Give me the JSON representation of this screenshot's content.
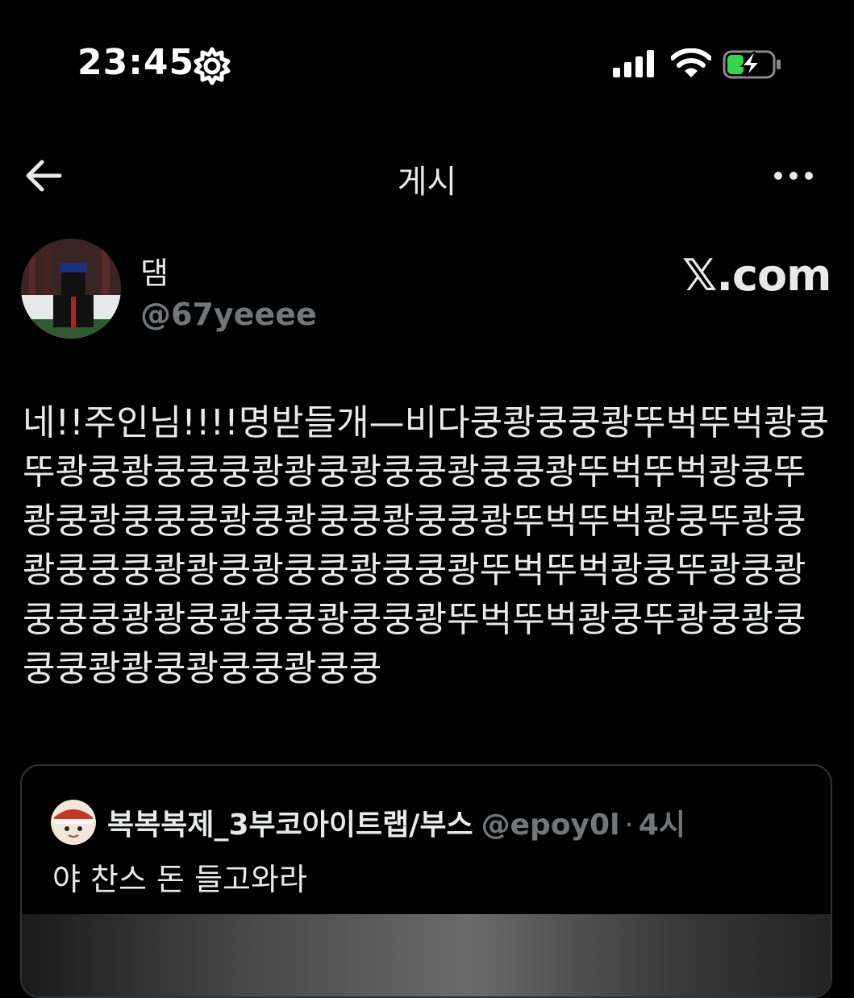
{
  "status_bar": {
    "time": "23:45",
    "icons": [
      "gear-icon",
      "signal-icon",
      "wifi-icon",
      "battery-charging-icon"
    ]
  },
  "header": {
    "title": "게시",
    "back_icon": "arrow-left-icon",
    "more_icon": "more-icon"
  },
  "author": {
    "name": "댐",
    "handle": "@67yeeee"
  },
  "watermark": "𝕏.com",
  "post": {
    "text": "네!!주인님!!!!명받들개—비다쿵쾅쿵쿵쾅뚜벅뚜벅쾅쿵뚜쾅쿵쾅쿵쿵쿵쾅쾅쿵쾅쿵쿵쾅쿵쿵쾅뚜벅뚜벅쾅쿵뚜쾅쿵쾅쿵쿵쿵쾅쿵쾅쿵쿵쾅쿵쿵쾅뚜벅뚜벅쾅쿵뚜쾅쿵쾅쿵쿵쿵쾅쾅쿵쾅쿵쿵쾅쿵쿵쾅뚜벅뚜벅쾅쿵뚜쾅쿵쾅쿵쿵쿵쾅쾅쿵쾅쿵쿵쾅쿵쿵쾅뚜벅뚜벅쾅쿵뚜쾅쿵쾅쿵쿵쿵쾅쾅쿵쾅쿵쿵쾅쿵쿵"
  },
  "quote": {
    "name": "복복복제_3부코아이트랩/부스",
    "handle": "@epoy0l",
    "separator": "·",
    "time": "4시",
    "text": "야 찬스 돈 들고와라"
  }
}
